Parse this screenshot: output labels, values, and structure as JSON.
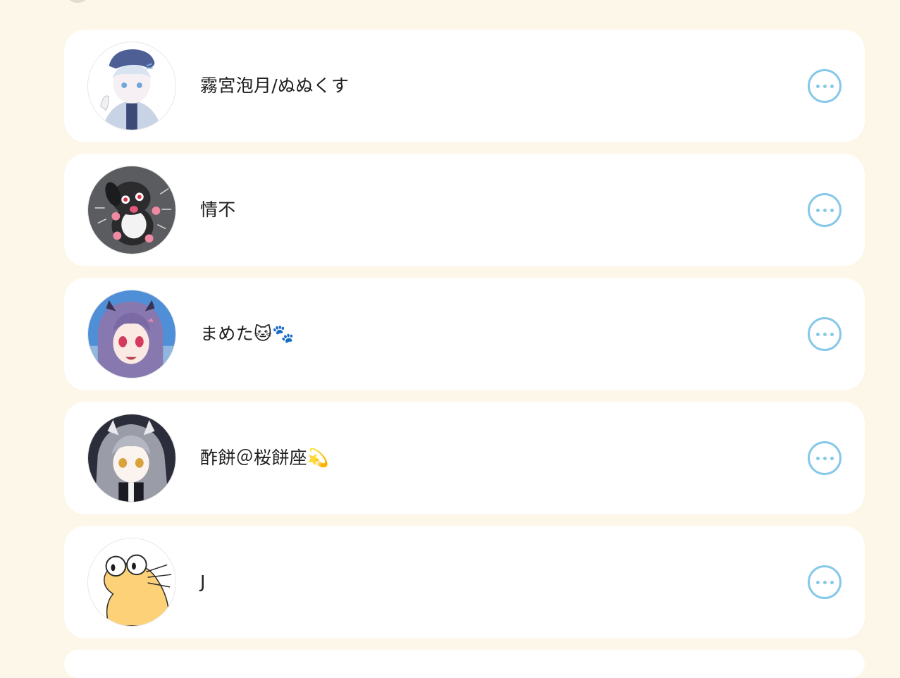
{
  "users": [
    {
      "name": "霧宮泡月/ぬぬくす",
      "avatar": "avatar-anime-boy-cap-icon"
    },
    {
      "name": "情不",
      "avatar": "avatar-black-puppy-icon"
    },
    {
      "name": "まめた🐱🐾",
      "avatar": "avatar-purple-hair-girl-icon"
    },
    {
      "name": "酢餅＠桜餅座💫",
      "avatar": "avatar-gray-hair-girl-icon"
    },
    {
      "name": "J",
      "avatar": "avatar-yellow-cartoon-icon"
    }
  ],
  "more_icon": "more-horizontal-icon",
  "colors": {
    "background": "#fdf7e9",
    "card": "#ffffff",
    "accent": "#86c8e8",
    "text": "#1e1e1e"
  }
}
